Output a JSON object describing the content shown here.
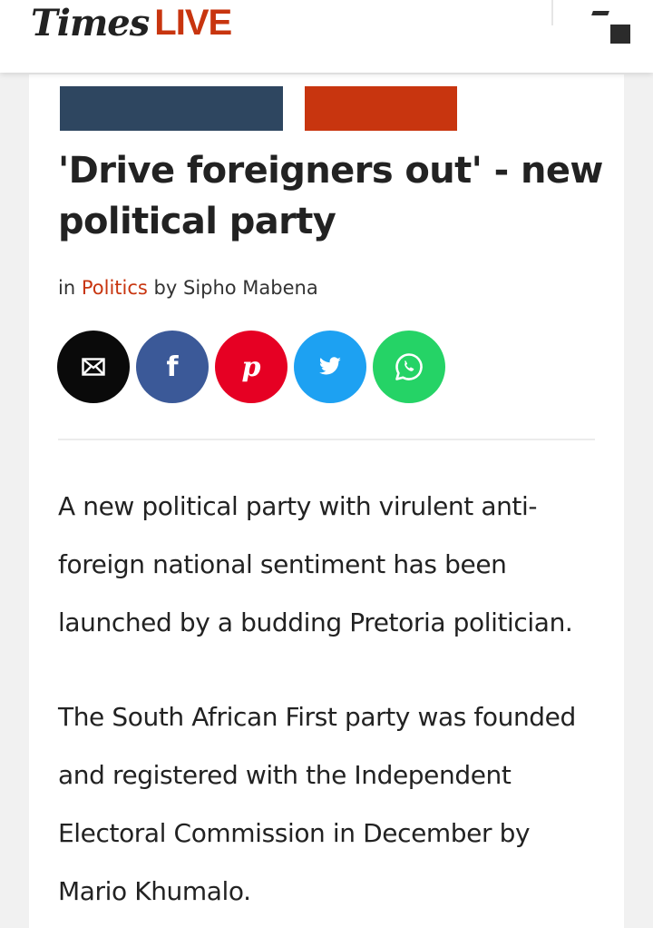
{
  "header": {
    "logo_times": "Times",
    "logo_live": "LIVE"
  },
  "colors": {
    "accent": "#c8350f",
    "banner_dark": "#2e4660",
    "email": "#0a0a0a",
    "facebook": "#3b5998",
    "pinterest": "#e60023",
    "twitter": "#1da1f2",
    "whatsapp": "#25d366"
  },
  "article": {
    "headline_line1": "'Drive foreigners out' - new",
    "headline_line2": "political party",
    "byline_in": "in",
    "category": "Politics",
    "byline_by": "by",
    "author": "Sipho Mabena",
    "paragraphs": [
      [
        "A new political party with virulent anti-",
        "foreign national sentiment has been",
        "launched by a budding Pretoria politician."
      ],
      [
        "The South African First party was founded",
        "and registered with the Independent",
        "Electoral Commission in December by",
        "Mario Khumalo."
      ]
    ]
  },
  "share_buttons": [
    {
      "icon": "envelope-icon"
    },
    {
      "icon": "facebook-icon",
      "glyph": "f"
    },
    {
      "icon": "pinterest-icon",
      "glyph": "p"
    },
    {
      "icon": "twitter-icon"
    },
    {
      "icon": "whatsapp-icon"
    }
  ]
}
